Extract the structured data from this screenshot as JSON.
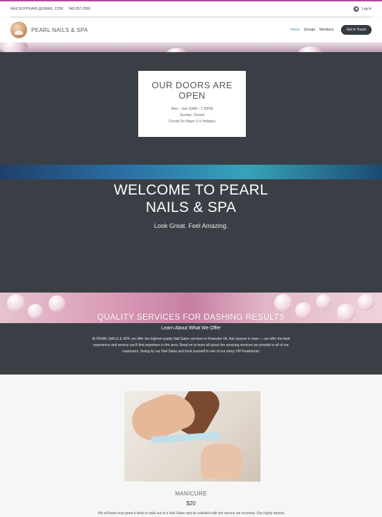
{
  "topbar": {
    "email": "NAILSOFPEARL@GMAIL.COM",
    "phone": "540-257-2366",
    "login_label": "Log In"
  },
  "header": {
    "brand": "PEARL NAILS & SPA",
    "nav": [
      {
        "label": "Home"
      },
      {
        "label": "Groups"
      },
      {
        "label": "Members"
      }
    ],
    "cta_label": "Get In Touch"
  },
  "hours": {
    "title": "OUR DOORS ARE OPEN",
    "lines": [
      "Mon – Sat 10AM – 7:30PM",
      "Sunday: Closed",
      "Closed On Major U.S Holidays"
    ]
  },
  "welcome": {
    "title_line1": "WELCOME TO PEARL",
    "title_line2": "NAILS & SPA",
    "tagline": "Look Great. Feel Amazing."
  },
  "services": {
    "title": "QUALITY SERVICES FOR DASHING RESULTS",
    "subtitle": "Learn About What We Offer",
    "paragraph": "At PEARL NAILS & SPA, we offer the highest quality Nail Salon services in Roanoke VA. Ask anyone in town — we offer the best experience and service you'll find anywhere in the area. Read on to learn all about the amazing services we provide to all of our customers. Swing by our Nail Salon and treat yourself to one of our many VIP treatments!"
  },
  "service_item": {
    "name": "MANICURE",
    "price": "$20",
    "description": "We all know how great it feels to walk out of a Nail Salon and be satisfied with the service we received. Our highly trained"
  },
  "colors": {
    "accent": "#b2479a",
    "dark_bg": "#3a3f46",
    "link_active": "#3e8ec4"
  }
}
